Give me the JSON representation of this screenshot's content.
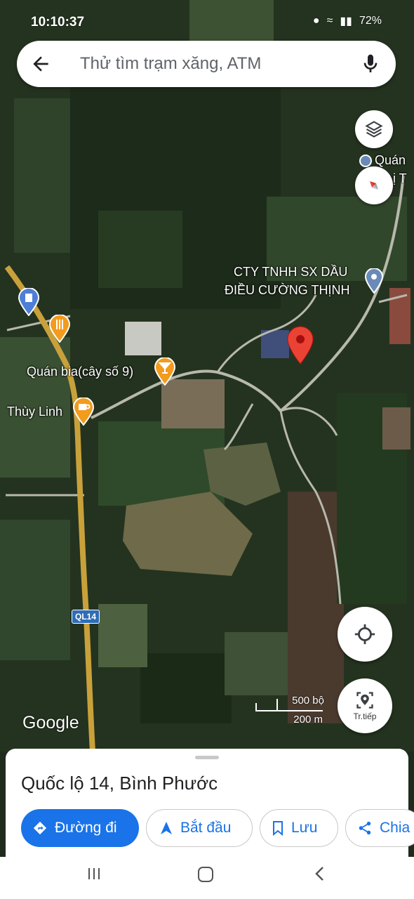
{
  "status_bar": {
    "time": "10:10:37",
    "battery": "72%"
  },
  "search": {
    "placeholder": "Thử tìm trạm xăng, ATM"
  },
  "map": {
    "labels": {
      "company_line1": "CTY TNHH SX DẦU",
      "company_line2": "ĐIỀU CƯỜNG THỊNH",
      "quan_bia": "Quán bia(cây số 9)",
      "thuy_linh": "Thùy Linh",
      "quan_partial_1": "Quán",
      "quan_partial_2": "ị T",
      "road_badge": "QL14"
    },
    "scale": {
      "imperial": "500 bộ",
      "metric": "200 m"
    },
    "logo": "Google",
    "explore_label": "Tr.tiếp"
  },
  "place": {
    "title": "Quốc lộ 14, Bình Phước"
  },
  "actions": {
    "directions": "Đường đi",
    "start": "Bắt đầu",
    "save": "Lưu",
    "share": "Chia"
  },
  "colors": {
    "accent": "#1a73e8",
    "pin": "#ea4335",
    "road": "#c9a13b",
    "poi_food": "#f29b1d",
    "poi_gas": "#4e7ed6"
  }
}
